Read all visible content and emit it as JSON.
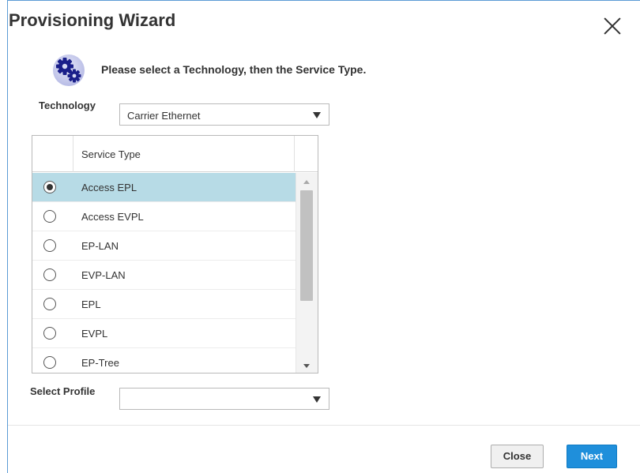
{
  "dialog": {
    "title": "Provisioning Wizard",
    "close_icon": "close-icon",
    "instruction": "Please select a Technology, then the Service Type.",
    "gear_icon": "gears-icon"
  },
  "technology": {
    "label": "Technology",
    "selected": "Carrier Ethernet"
  },
  "service_grid": {
    "header": "Service Type",
    "rows": [
      {
        "label": "Access EPL",
        "selected": true
      },
      {
        "label": "Access EVPL",
        "selected": false
      },
      {
        "label": "EP-LAN",
        "selected": false
      },
      {
        "label": "EVP-LAN",
        "selected": false
      },
      {
        "label": "EPL",
        "selected": false
      },
      {
        "label": "EVPL",
        "selected": false
      },
      {
        "label": "EP-Tree",
        "selected": false
      }
    ]
  },
  "profile": {
    "label": "Select Profile",
    "selected": ""
  },
  "buttons": {
    "close": "Close",
    "next": "Next"
  },
  "colors": {
    "selected_row": "#b7dbe6",
    "primary_button": "#1f8fdb",
    "dialog_border": "#5b9bd5"
  }
}
